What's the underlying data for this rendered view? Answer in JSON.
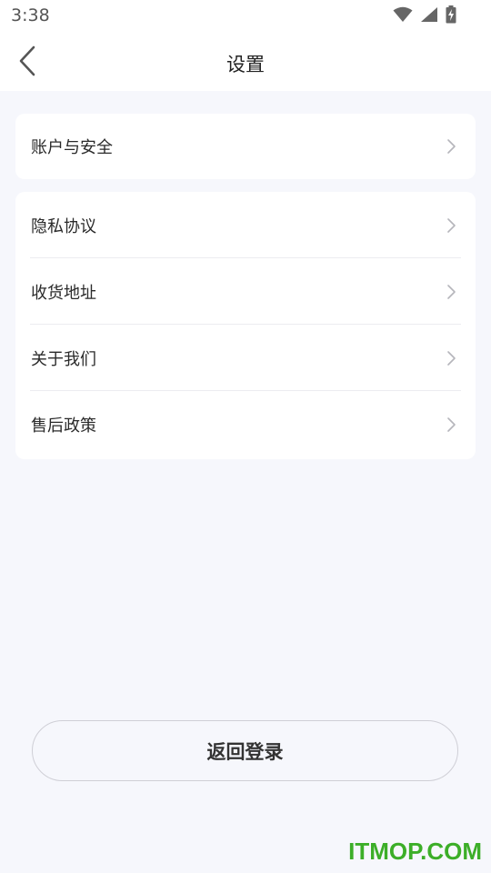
{
  "status_bar": {
    "time": "3:38",
    "icons": [
      "wifi-icon",
      "signal-icon",
      "battery-charging-icon"
    ]
  },
  "header": {
    "back_icon": "chevron-left-icon",
    "title": "设置"
  },
  "groups": [
    {
      "items": [
        {
          "label": "账户与安全",
          "icon": "chevron-right-icon"
        }
      ]
    },
    {
      "items": [
        {
          "label": "隐私协议",
          "icon": "chevron-right-icon"
        },
        {
          "label": "收货地址",
          "icon": "chevron-right-icon"
        },
        {
          "label": "关于我们",
          "icon": "chevron-right-icon"
        },
        {
          "label": "售后政策",
          "icon": "chevron-right-icon"
        }
      ]
    }
  ],
  "logout_button": {
    "label": "返回登录"
  },
  "watermark": {
    "text": "ITMOP.COM",
    "color": "#3cae28"
  },
  "colors": {
    "background": "#f6f7fc",
    "card": "#ffffff",
    "text": "#222222",
    "chevron": "#b5b5bb"
  }
}
